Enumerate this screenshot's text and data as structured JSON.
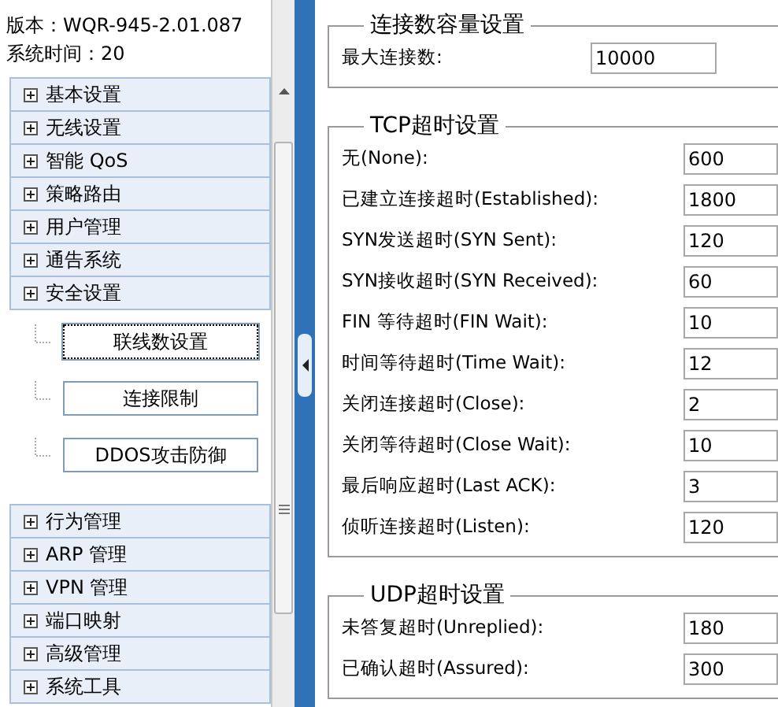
{
  "header": {
    "version": "版本：WQR-945-2.01.087",
    "system_line": "系统时间：20"
  },
  "menu": [
    {
      "label": "基本设置"
    },
    {
      "label": "无线设置"
    },
    {
      "label": "智能 QoS"
    },
    {
      "label": "策略路由"
    },
    {
      "label": "用户管理"
    },
    {
      "label": "通告系统"
    },
    {
      "label": "安全设置",
      "children": [
        {
          "label": "联线数设置",
          "selected": true
        },
        {
          "label": "连接限制",
          "selected": false
        },
        {
          "label": "DDOS攻击防御",
          "selected": false
        }
      ]
    },
    {
      "label": "行为管理"
    },
    {
      "label": "ARP 管理"
    },
    {
      "label": "VPN 管理"
    },
    {
      "label": "端口映射"
    },
    {
      "label": "高级管理"
    },
    {
      "label": "系统工具"
    }
  ],
  "sections": [
    {
      "title": "连接数容量设置",
      "fields": [
        {
          "label": "最大连接数:",
          "value": "10000"
        }
      ]
    },
    {
      "title": "TCP超时设置",
      "fields": [
        {
          "label": "无(None):",
          "value": "600"
        },
        {
          "label": "已建立连接超时(Established):",
          "value": "1800"
        },
        {
          "label": "SYN发送超时(SYN Sent):",
          "value": "120"
        },
        {
          "label": "SYN接收超时(SYN Received):",
          "value": "60"
        },
        {
          "label": "FIN 等待超时(FIN Wait):",
          "value": "10"
        },
        {
          "label": "时间等待超时(Time Wait):",
          "value": "12"
        },
        {
          "label": "关闭连接超时(Close):",
          "value": "2"
        },
        {
          "label": "关闭等待超时(Close Wait):",
          "value": "10"
        },
        {
          "label": "最后响应超时(Last ACK):",
          "value": "3"
        },
        {
          "label": "侦听连接超时(Listen):",
          "value": "120"
        }
      ]
    },
    {
      "title": "UDP超时设置",
      "fields": [
        {
          "label": "未答复超时(Unreplied):",
          "value": "180"
        },
        {
          "label": "已确认超时(Assured):",
          "value": "300"
        }
      ]
    }
  ]
}
